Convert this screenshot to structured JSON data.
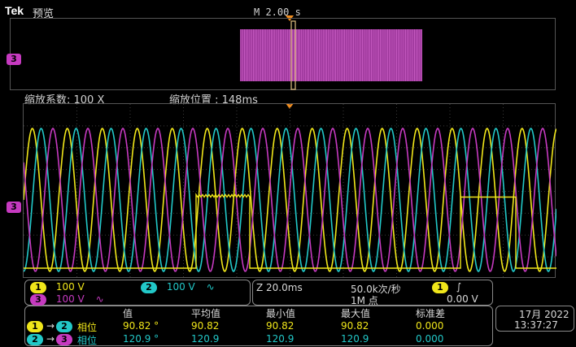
{
  "header": {
    "brand": "Tek",
    "mode": "预览",
    "timebase": "M 2.00 s"
  },
  "zoom": {
    "factor_label": "缩放系数: 100 X",
    "position_label": "缩放位置 : 148ms"
  },
  "markers": {
    "overview_ch3": "3",
    "main_ch3": "3"
  },
  "channels": {
    "ch1": {
      "num": "1",
      "scale": "100 V",
      "color": "#f0e61a"
    },
    "ch2": {
      "num": "2",
      "scale": "100 V",
      "color": "#22c8c8",
      "coupling_icon": "∿"
    },
    "ch3": {
      "num": "3",
      "scale": "100 V",
      "color": "#c63ac0",
      "coupling_icon": "∿"
    }
  },
  "horizontal": {
    "zoom_scale": "Z 20.0ms",
    "sample_rate": "50.0k次/秒",
    "record_length": "1M 点"
  },
  "trigger": {
    "source": "1",
    "slope_icon": "∫",
    "level": "0.00 V"
  },
  "measurements": {
    "headers": [
      "值",
      "平均值",
      "最小值",
      "最大值",
      "标准差"
    ],
    "rows": [
      {
        "from": "1",
        "to": "2",
        "label": "相位",
        "value": "90.82 °",
        "mean": "90.82",
        "min": "90.82",
        "max": "90.82",
        "std": "0.000",
        "color": "#f0e61a"
      },
      {
        "from": "2",
        "to": "3",
        "label": "相位",
        "value": "120.9 °",
        "mean": "120.9",
        "min": "120.9",
        "max": "120.9",
        "std": "0.000",
        "color": "#22c8c8"
      }
    ]
  },
  "clock": {
    "date": "17月 2022",
    "time": "13:37:27"
  }
}
